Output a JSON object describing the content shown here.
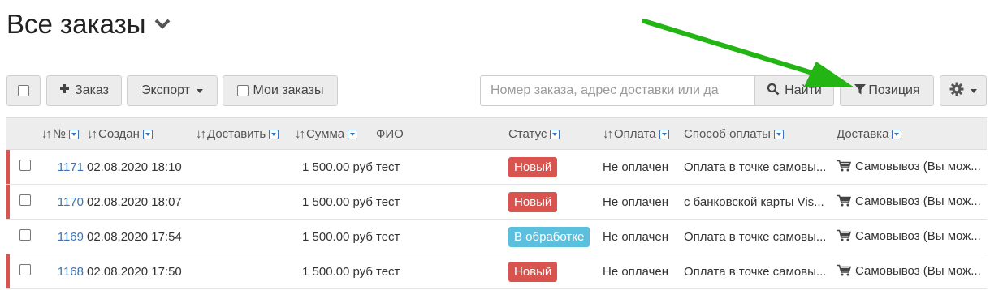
{
  "header": {
    "title": "Все заказы"
  },
  "toolbar": {
    "add_label": "Заказ",
    "export_label": "Экспорт",
    "my_orders_label": "Мои заказы",
    "search_placeholder": "Номер заказа, адрес доставки или да",
    "search_button_label": "Найти",
    "position_filter_label": "Позиция"
  },
  "table": {
    "columns": {
      "number": "№",
      "created": "Создан",
      "deliver": "Доставить",
      "sum": "Сумма",
      "fio": "ФИО",
      "status": "Статус",
      "payment": "Оплата",
      "payment_method": "Способ оплаты",
      "delivery": "Доставка"
    },
    "rows": [
      {
        "number": "1171",
        "created": "02.08.2020 18:10",
        "sum": "1 500.00 руб",
        "fio": "тест",
        "status": "Новый",
        "payment": "Не оплачен",
        "payment_method": "Оплата в точке самовы...",
        "delivery": "Самовывоз (Вы мож..."
      },
      {
        "number": "1170",
        "created": "02.08.2020 18:07",
        "sum": "1 500.00 руб",
        "fio": "тест",
        "status": "Новый",
        "payment": "Не оплачен",
        "payment_method": "с банковской карты Vis...",
        "delivery": "Самовывоз (Вы мож..."
      },
      {
        "number": "1169",
        "created": "02.08.2020 17:54",
        "sum": "1 500.00 руб",
        "fio": "тест",
        "status": "В обработке",
        "payment": "Не оплачен",
        "payment_method": "Оплата в точке самовы...",
        "delivery": "Самовывоз (Вы мож..."
      },
      {
        "number": "1168",
        "created": "02.08.2020 17:50",
        "sum": "1 500.00 руб",
        "fio": "тест",
        "status": "Новый",
        "payment": "Не оплачен",
        "payment_method": "Оплата в точке самовы...",
        "delivery": "Самовывоз (Вы мож..."
      }
    ]
  },
  "colors": {
    "status_new": "#d9534f",
    "status_processing": "#5bc0de",
    "link": "#3a73b5",
    "annotation_arrow": "#22b513"
  },
  "icons": [
    "chevron-down-icon",
    "plus-icon",
    "search-icon",
    "filter-icon",
    "gear-icon",
    "sort-icon",
    "cart-icon"
  ]
}
